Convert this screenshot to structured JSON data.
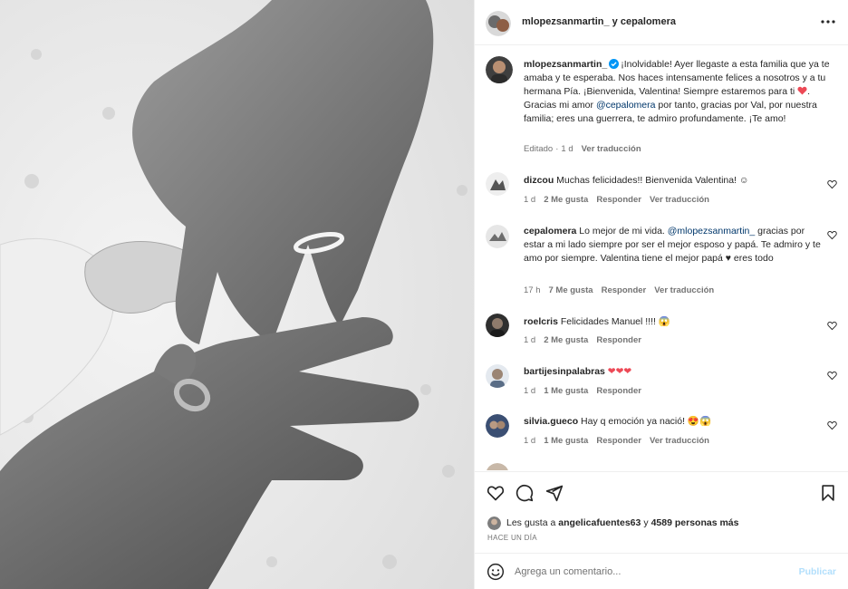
{
  "colors": {
    "mention": "#00376b",
    "heart": "#ed4956",
    "muted": "#737373",
    "publish_disabled": "#b2dffc",
    "verified": "#0095f6"
  },
  "post": {
    "photo_alt": "black and white photo of hands with wedding rings holding a baby's hand",
    "header": {
      "user1": "mlopezsanmartin_",
      "sep": " y ",
      "user2": "cepalomera"
    },
    "more_icon": "more-horizontal-icon"
  },
  "caption": {
    "username": "mlopezsanmartin_",
    "text_a": "¡Inolvidable! Ayer llegaste a esta familia que ya te amaba y te esperaba. Nos haces intensamente felices a nosotros y a tu hermana Pía. ¡Bienvenida, Valentina! Siempre estaremos para ti ",
    "text_b": ". Gracias mi amor ",
    "mention": "@cepalomera",
    "text_c": " por tanto, gracias por Val, por nuestra familia; eres una guerrera, te admiro profundamente. ¡Te amo!",
    "edited": "Editado",
    "dot": "·",
    "time": "1 d",
    "translate": "Ver traducción"
  },
  "comments": [
    {
      "username": "dizcou",
      "text": "Muchas felicidades!! Bienvenida Valentina! ☺",
      "time": "1 d",
      "likes": "2 Me gusta",
      "reply": "Responder",
      "translate": "Ver traducción"
    },
    {
      "username": "cepalomera",
      "text_a": "Lo mejor de mi vida. ",
      "mention": "@mlopezsanmartin_",
      "text_b": " gracias por estar a mi lado siempre por ser el mejor esposo y papá. Te admiro y te amo por siempre. Valentina tiene el mejor papá ♥ eres todo",
      "time": "17 h",
      "likes": "7 Me gusta",
      "reply": "Responder",
      "translate": "Ver traducción"
    },
    {
      "username": "roelcris",
      "text": "Felicidades Manuel !!!! 😱",
      "time": "1 d",
      "likes": "2 Me gusta",
      "reply": "Responder"
    },
    {
      "username": "bartijesinpalabras",
      "text": "❤❤❤",
      "time": "1 d",
      "likes": "1 Me gusta",
      "reply": "Responder"
    },
    {
      "username": "silvia.gueco",
      "text": "Hay q emoción ya nació! 😍😱",
      "time": "1 d",
      "likes": "1 Me gusta",
      "reply": "Responder",
      "translate": "Ver traducción"
    }
  ],
  "actions": {
    "like_icon": "heart-icon",
    "comment_icon": "comment-icon",
    "share_icon": "send-icon",
    "save_icon": "bookmark-icon"
  },
  "likes": {
    "prefix": "Les gusta a",
    "user": "angelicafuentes63",
    "and": "y",
    "count": "4589 personas más"
  },
  "timestamp": "HACE UN DÍA",
  "add_comment": {
    "placeholder": "Agrega un comentario...",
    "publish": "Publicar",
    "emoji_icon": "smile-icon"
  }
}
